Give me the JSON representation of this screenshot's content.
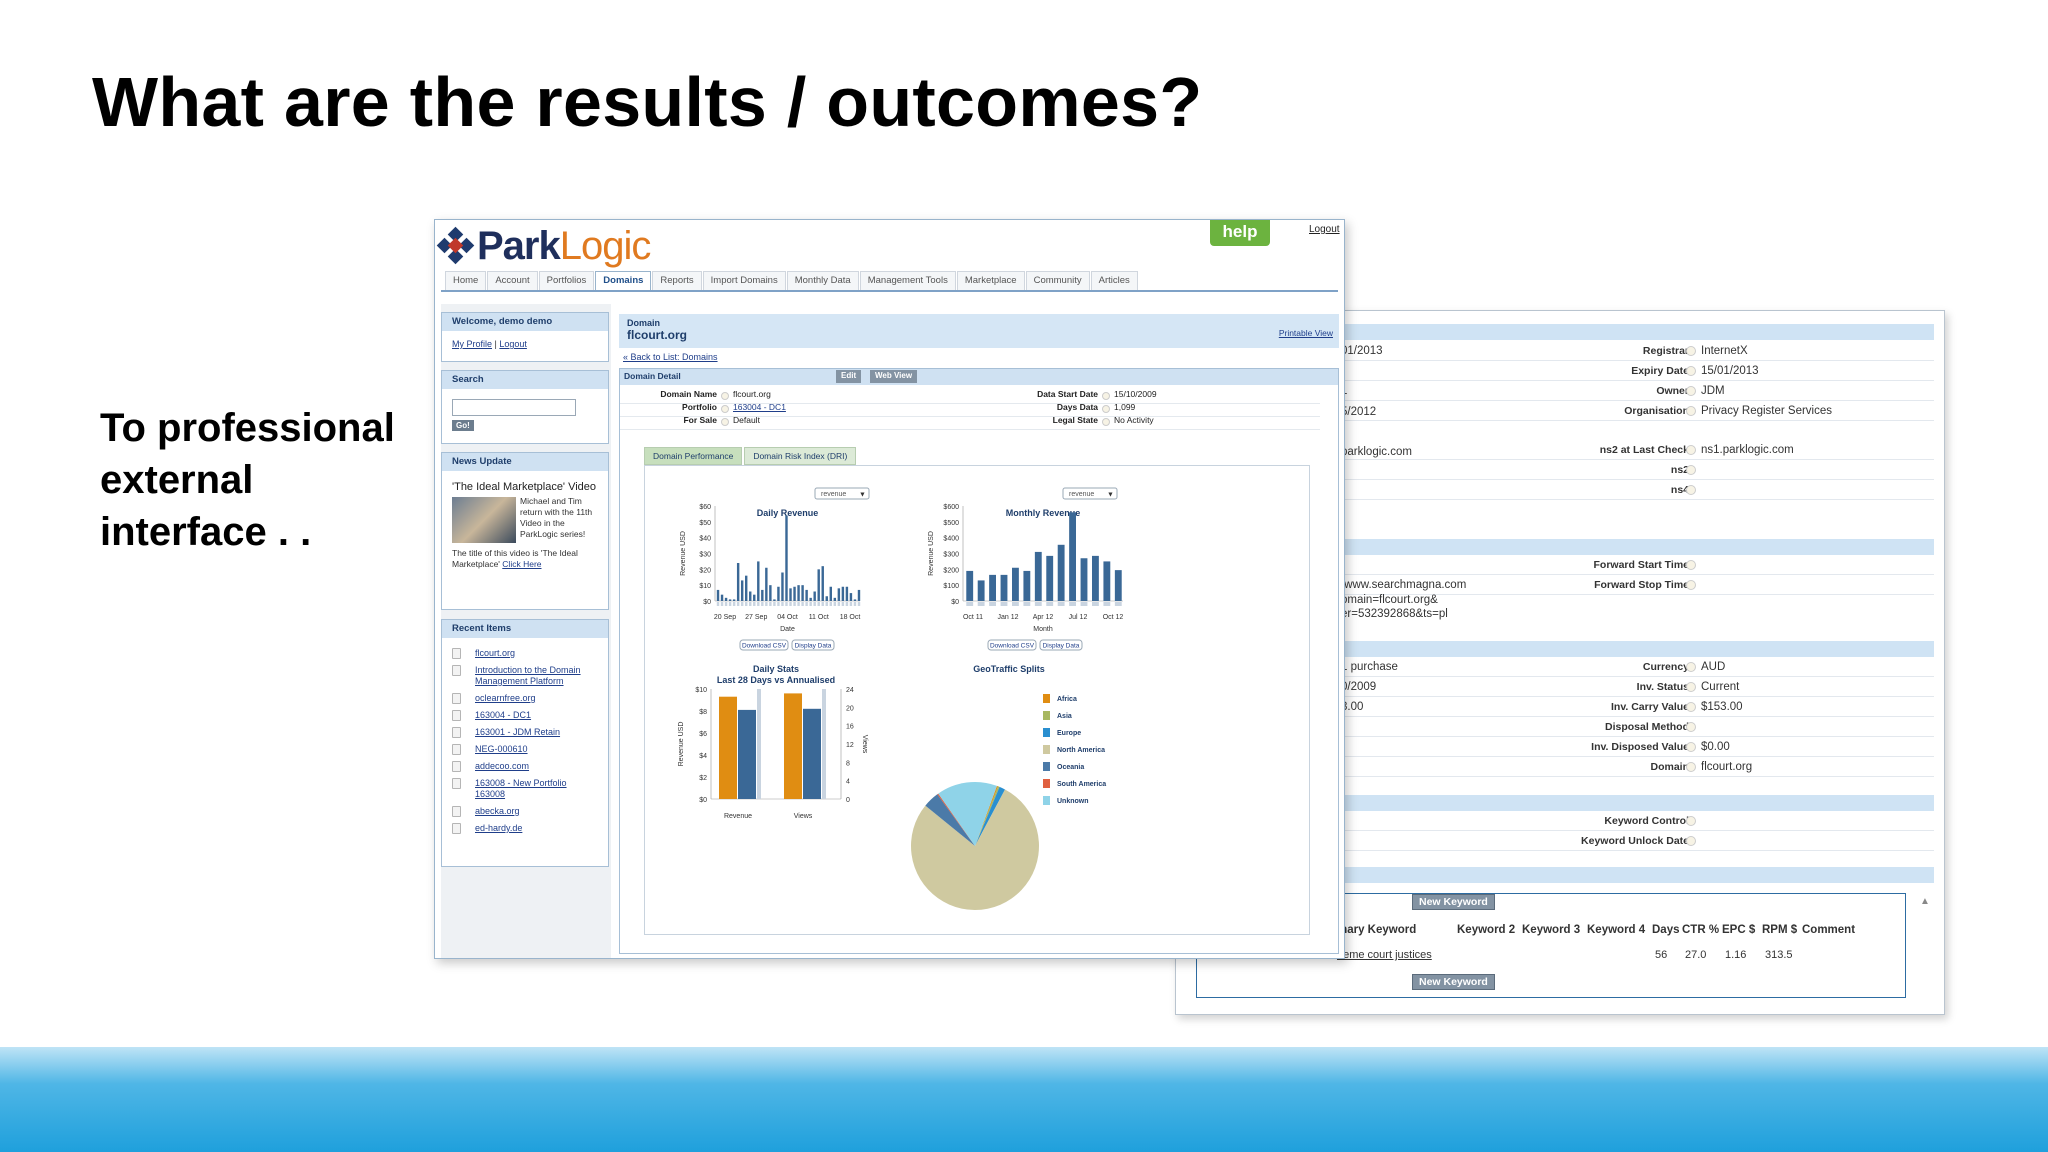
{
  "slide": {
    "title": "What are the results / outcomes?",
    "side_text": "To professional external interface . ."
  },
  "app": {
    "logo_park": "Park",
    "logo_logic": "Logic",
    "help": "help",
    "logout": "Logout",
    "nav": [
      "Home",
      "Account",
      "Portfolios",
      "Domains",
      "Reports",
      "Import Domains",
      "Monthly Data",
      "Management Tools",
      "Marketplace",
      "Community",
      "Articles"
    ],
    "nav_active": "Domains"
  },
  "sidebar": {
    "welcome": "Welcome, demo demo",
    "my_profile": "My Profile",
    "sep": "|",
    "logout": "Logout",
    "search_title": "Search",
    "go": "Go!",
    "news_title": "News Update",
    "news_headline": "'The Ideal Marketplace' Video",
    "news_body": "Michael and Tim return with the 11th Video in the ParkLogic series!",
    "news_caption": "The title of this video is 'The Ideal Marketplace'",
    "click_here": "Click Here",
    "recent_title": "Recent Items",
    "recent_items": [
      "flcourt.org",
      "Introduction to the Domain Management Platform",
      "oclearnfree.org",
      "163004 - DC1",
      "163001 - JDM Retain",
      "NEG-000610",
      "addecoo.com",
      "163008 - New Portfolio 163008",
      "abecka.org",
      "ed-hardy.de"
    ]
  },
  "domain": {
    "label": "Domain",
    "name": "flcourt.org",
    "printable": "Printable View",
    "back": "« Back to List: Domains",
    "detail_title": "Domain Detail",
    "edit": "Edit",
    "web_view": "Web View",
    "fields_left": [
      {
        "label": "Domain Name",
        "value": "flcourt.org"
      },
      {
        "label": "Portfolio",
        "value": "163004 - DC1"
      },
      {
        "label": "For Sale",
        "value": "Default"
      }
    ],
    "fields_right": [
      {
        "label": "Data Start Date",
        "value": "15/10/2009"
      },
      {
        "label": "Days Data",
        "value": "1,099"
      },
      {
        "label": "Legal State",
        "value": "No Activity"
      }
    ],
    "tabs": [
      "Domain Performance",
      "Domain Risk Index (DRI)"
    ]
  },
  "charts": {
    "download_csv": "Download CSV",
    "display_data": "Display Data",
    "dropdown_value": "revenue"
  },
  "chart_data": [
    {
      "type": "bar",
      "title": "Daily Revenue",
      "xlabel": "Date",
      "ylabel": "Revenue USD",
      "ylim": [
        0,
        60
      ],
      "y_ticks": [
        "$0",
        "$10",
        "$20",
        "$30",
        "$40",
        "$50",
        "$60"
      ],
      "x_ticks": [
        "20 Sep",
        "27 Sep",
        "04 Oct",
        "11 Oct",
        "18 Oct"
      ],
      "values": [
        7,
        4,
        2,
        1,
        1,
        24,
        13,
        16,
        6,
        4,
        25,
        7,
        21,
        10,
        1,
        9,
        18,
        54,
        8,
        9,
        10,
        10,
        7,
        2,
        6,
        20,
        22,
        3,
        9,
        2,
        8,
        9,
        9,
        5,
        1,
        7
      ]
    },
    {
      "type": "bar",
      "title": "Monthly Revenue",
      "xlabel": "Month",
      "ylabel": "Revenue USD",
      "ylim": [
        0,
        600
      ],
      "y_ticks": [
        "$0",
        "$100",
        "$200",
        "$300",
        "$400",
        "$500",
        "$600"
      ],
      "x_ticks": [
        "Oct 11",
        "Jan 12",
        "Apr 12",
        "Jul 12",
        "Oct 12"
      ],
      "values": [
        190,
        130,
        165,
        165,
        210,
        190,
        310,
        285,
        355,
        560,
        270,
        285,
        250,
        195
      ]
    },
    {
      "type": "bar",
      "title": "Daily Stats",
      "subtitle": "Last 28 Days vs Annualised",
      "ylabel": "Revenue USD",
      "y2label": "Views",
      "ylim": [
        0,
        10
      ],
      "y2lim": [
        0,
        24
      ],
      "y_ticks": [
        "$0",
        "$2",
        "$4",
        "$6",
        "$8",
        "$10"
      ],
      "y2_ticks": [
        "0",
        "4",
        "8",
        "12",
        "16",
        "20",
        "24"
      ],
      "categories": [
        "Revenue",
        "Views"
      ],
      "series": [
        {
          "color": "#e08d12",
          "values": [
            9.3,
            9.6
          ]
        },
        {
          "color": "#3a6896",
          "values": [
            8.1,
            8.2
          ]
        }
      ]
    },
    {
      "type": "pie",
      "title": "GeoTraffic Splits",
      "legend": [
        "Africa",
        "Asia",
        "Europe",
        "North America",
        "Oceania",
        "South America",
        "Unknown"
      ],
      "colors": [
        "#e08d12",
        "#a8b860",
        "#2a8fd0",
        "#cfc9a0",
        "#4b7aa8",
        "#e06040",
        "#8fd3e8"
      ],
      "values": [
        0.3,
        0.4,
        1.5,
        78.1,
        4.1,
        0.3,
        15.3
      ]
    }
  ],
  "back_window": {
    "rows_left": [
      "01/2013",
      "1",
      "5/2012",
      "parklogic.com"
    ],
    "rows_right": [
      {
        "label": "Registrar",
        "value": "InternetX"
      },
      {
        "label": "Expiry Date",
        "value": "15/01/2013"
      },
      {
        "label": "Owner",
        "value": "JDM"
      },
      {
        "label": "Organisation",
        "value": "Privacy Register Services"
      },
      {
        "label": "ns2 at Last Check",
        "value": "ns1.parklogic.com"
      },
      {
        "label": "ns2",
        "value": ""
      },
      {
        "label": "ns4",
        "value": ""
      }
    ],
    "forward_left": [
      "/www.searchmagna.com",
      "omain=flcourt.org&",
      "er=532392868&ts=pl"
    ],
    "forward_right": [
      {
        "label": "Forward Start Time",
        "value": ""
      },
      {
        "label": "Forward Stop Time",
        "value": ""
      }
    ],
    "inv_left": [
      "1 purchase",
      "0/2009",
      "3.00"
    ],
    "inv_right": [
      {
        "label": "Currency",
        "value": "AUD"
      },
      {
        "label": "Inv. Status",
        "value": "Current"
      },
      {
        "label": "Inv. Carry Value",
        "value": "$153.00"
      },
      {
        "label": "Disposal Method",
        "value": ""
      },
      {
        "label": "Inv. Disposed Value",
        "value": "$0.00"
      },
      {
        "label": "Domain",
        "value": "flcourt.org"
      }
    ],
    "kw_right": [
      {
        "label": "Keyword Control",
        "value": ""
      },
      {
        "label": "Keyword Unlock Date",
        "value": ""
      }
    ],
    "new_keyword": "New Keyword",
    "kw_headers": [
      "mary Keyword",
      "Keyword 2",
      "Keyword 3",
      "Keyword 4",
      "Days",
      "CTR %",
      "EPC $",
      "RPM $",
      "Comment"
    ],
    "kw_row": [
      "ireme court justices",
      "56",
      "27.0",
      "1.16",
      "313.5"
    ]
  }
}
